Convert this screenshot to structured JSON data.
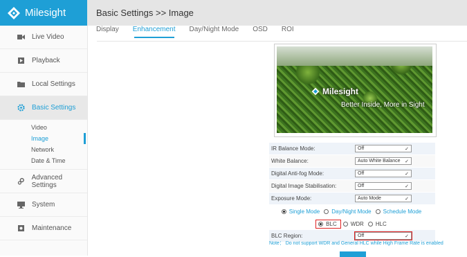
{
  "brand": {
    "name": "Milesight"
  },
  "sidebar": {
    "items": [
      {
        "label": "Live Video",
        "icon": "video-icon"
      },
      {
        "label": "Playback",
        "icon": "playback-icon"
      },
      {
        "label": "Local Settings",
        "icon": "folder-icon"
      },
      {
        "label": "Basic Settings",
        "icon": "gear-icon"
      },
      {
        "label": "Advanced Settings",
        "icon": "advanced-gear-icon"
      },
      {
        "label": "System",
        "icon": "monitor-icon"
      },
      {
        "label": "Maintenance",
        "icon": "maintenance-icon"
      }
    ],
    "subitems": [
      "Video",
      "Image",
      "Network",
      "Date & Time"
    ]
  },
  "header": {
    "breadcrumb": "Basic Settings >> Image"
  },
  "tabs": [
    "Display",
    "Enhancement",
    "Day/Night Mode",
    "OSD",
    "ROI"
  ],
  "preview": {
    "logo_text": "Milesight",
    "tagline": "Better Inside, More in Sight"
  },
  "form": {
    "ir_balance": {
      "label": "IR Balance Mode:",
      "value": "Off"
    },
    "white_balance": {
      "label": "White Balance:",
      "value": "Auto White Balance"
    },
    "antifog": {
      "label": "Digital Anti-fog Mode:",
      "value": "Off"
    },
    "stabilisation": {
      "label": "Digital Image Stabilisation:",
      "value": "Off"
    },
    "exposure": {
      "label": "Exposure Mode:",
      "value": "Auto Mode"
    },
    "mode_radios": [
      "Single Mode",
      "Day/Night Mode",
      "Schedule Mode"
    ],
    "blc_radios": [
      "BLC",
      "WDR",
      "HLC"
    ],
    "blc_region": {
      "label": "BLC Region:",
      "value": "Off"
    }
  },
  "note": "Note： Do not support WDR and General HLC while High Frame Rate is enabled",
  "colors": {
    "accent": "#1e9fd6",
    "highlight": "#e02020"
  }
}
